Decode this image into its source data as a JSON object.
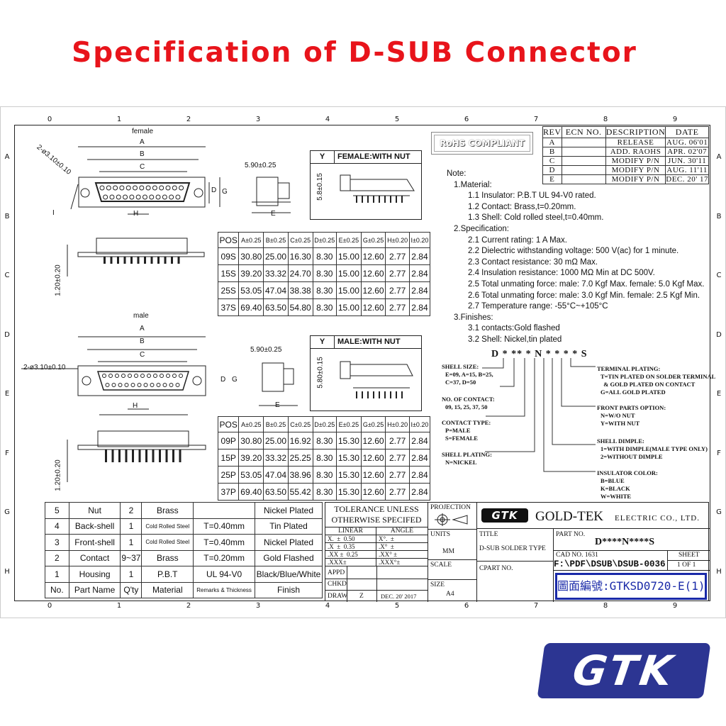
{
  "title": "Specification of D-SUB Connector",
  "grid": {
    "columns": [
      "0",
      "1",
      "2",
      "3",
      "4",
      "5",
      "6",
      "7",
      "8",
      "9"
    ],
    "rows": [
      "A",
      "B",
      "C",
      "D",
      "E",
      "F",
      "G",
      "H"
    ]
  },
  "rohs": "RoHS COMPLIANT",
  "revisions": {
    "headers": [
      "REV",
      "ECN NO.",
      "DESCRIPTION",
      "DATE"
    ],
    "rows": [
      [
        "A",
        "",
        "RELEASE",
        "AUG. 06'01"
      ],
      [
        "B",
        "",
        "ADD. RAOHS",
        "APR. 02'07"
      ],
      [
        "C",
        "",
        "MODIFY P/N",
        "JUN. 30'11"
      ],
      [
        "D",
        "",
        "MODIFY P/N",
        "AUG. 11'11"
      ],
      [
        "E",
        "",
        "MODIFY P/N",
        "DEC. 20' 17"
      ]
    ]
  },
  "female": {
    "label": "female",
    "hole": "2-ø3.10±0.10",
    "side_dim": "5.90±0.25",
    "height_dim": "1.20±0.20",
    "letters": {
      "a": "A",
      "b": "B",
      "c": "C",
      "d": "D",
      "g": "G",
      "h": "H",
      "e": "E",
      "i": "I"
    },
    "y_box": {
      "y": "Y",
      "title": "FEMALE:WITH NUT",
      "dim": "5.8±0.15"
    },
    "table": {
      "headers": [
        "POS",
        "A±0.25",
        "B±0.25",
        "C±0.25",
        "D±0.25",
        "E±0.25",
        "G±0.25",
        "H±0.20",
        "I±0.20"
      ],
      "rows": [
        [
          "09S",
          "30.80",
          "25.00",
          "16.30",
          "8.30",
          "15.00",
          "12.60",
          "2.77",
          "2.84"
        ],
        [
          "15S",
          "39.20",
          "33.32",
          "24.70",
          "8.30",
          "15.00",
          "12.60",
          "2.77",
          "2.84"
        ],
        [
          "25S",
          "53.05",
          "47.04",
          "38.38",
          "8.30",
          "15.00",
          "12.60",
          "2.77",
          "2.84"
        ],
        [
          "37S",
          "69.40",
          "63.50",
          "54.80",
          "8.30",
          "15.00",
          "12.60",
          "2.77",
          "2.84"
        ]
      ]
    }
  },
  "male": {
    "label": "male",
    "hole": "2-ø3.10±0.10",
    "side_dim": "5.90±0.25",
    "height_dim": "1.20±0.20",
    "letters": {
      "a": "A",
      "b": "B",
      "c": "C",
      "d": "D",
      "g": "G",
      "h": "H",
      "e": "E"
    },
    "y_box": {
      "y": "Y",
      "title": "MALE:WITH NUT",
      "dim": "5.80±0.15"
    },
    "table": {
      "headers": [
        "POS",
        "A±0.25",
        "B±0.25",
        "C±0.25",
        "D±0.25",
        "E±0.25",
        "G±0.25",
        "H±0.20",
        "I±0.20"
      ],
      "rows": [
        [
          "09P",
          "30.80",
          "25.00",
          "16.92",
          "8.30",
          "15.30",
          "12.60",
          "2.77",
          "2.84"
        ],
        [
          "15P",
          "39.20",
          "33.32",
          "25.25",
          "8.30",
          "15.30",
          "12.60",
          "2.77",
          "2.84"
        ],
        [
          "25P",
          "53.05",
          "47.04",
          "38.96",
          "8.30",
          "15.30",
          "12.60",
          "2.77",
          "2.84"
        ],
        [
          "37P",
          "69.40",
          "63.50",
          "55.42",
          "8.30",
          "15.30",
          "12.60",
          "2.77",
          "2.84"
        ]
      ]
    }
  },
  "notes": [
    "Note:",
    "1.Material:",
    "1.1 Insulator: P.B.T UL 94-V0 rated.",
    "1.2 Contact: Brass,t=0.20mm.",
    "1.3 Shell: Cold rolled steel,t=0.40mm.",
    "2.Specification:",
    "2.1 Current rating: 1 A Max.",
    "2.2 Dielectric withstanding voltage: 500 V(ac) for 1 minute.",
    "2.3 Contact resistance: 30 mΩ Max.",
    "2.4 Insulation resistance: 1000 MΩ Min at DC 500V.",
    "2.5 Total unmating force: male: 7.0 Kgf Max.  female: 5.0 Kgf Max.",
    "2.6 Total unmating force: male: 3.0 Kgf Min.  female: 2.5 Kgf Min.",
    "2.7 Temperature range: -55°C~+105°C",
    "3.Finishes:",
    "3.1 contacts:Gold flashed",
    "3.2 Shell: Nickel,tin plated"
  ],
  "part_code": {
    "code": "D * ** * N * * * * S",
    "shell_size": [
      "SHELL SIZE:",
      "E=09, A=15, B=25,",
      "C=37, D=50"
    ],
    "contacts": [
      "NO. OF CONTACT:",
      "09, 15, 25, 37, 50"
    ],
    "contact_type": [
      "CONTACT TYPE:",
      "P=MALE",
      "S=FEMALE"
    ],
    "shell_plating": [
      "SHELL PLATING:",
      "N=NICKEL"
    ],
    "terminal_plating": [
      "TERMINAL PLATING:",
      "T=TIN PLATED ON SOLDER TERMINAL",
      "  & GOLD PLATED ON CONTACT",
      "G=ALL GOLD PLATED"
    ],
    "front_parts": [
      "FRONT PARTS OPTION:",
      "N=W/O NUT",
      "Y=WITH NUT"
    ],
    "shell_dimple": [
      "SHELL DIMPLE:",
      "1=WITH DIMPLE(MALE TYPE ONLY)",
      "2=WITHOUT DIMPLE"
    ],
    "insulator_color": [
      "INSULATOR COLOR:",
      "B=BLUE",
      "K=BLACK",
      "W=WHITE"
    ]
  },
  "bom": {
    "rows": [
      [
        "5",
        "Nut",
        "2",
        "Brass",
        "",
        "Nickel Plated"
      ],
      [
        "4",
        "Back-shell",
        "1",
        "Cold Rolled Steel",
        "T=0.40mm",
        "Tin Plated"
      ],
      [
        "3",
        "Front-shell",
        "1",
        "Cold Rolled Steel",
        "T=0.40mm",
        "Nickel Plated"
      ],
      [
        "2",
        "Contact",
        "9~37",
        "Brass",
        "T=0.20mm",
        "Gold Flashed"
      ],
      [
        "1",
        "Housing",
        "1",
        "P.B.T",
        "UL 94-V0",
        "Black/Blue/White"
      ]
    ],
    "headers": [
      "No.",
      "Part Name",
      "Q'ty",
      "Material",
      "Remarks & Thickness",
      "Finish"
    ]
  },
  "title_block": {
    "tolerance": [
      "TOLERANCE UNLESS",
      "OTHERWISE SPECIFED"
    ],
    "linear": "LINEAR",
    "angle": "ANGLE",
    "tol_rows": [
      [
        "X.  ±  0.50",
        "X°.  ±"
      ],
      [
        ".X  ±  0.35",
        ".X°  ±"
      ],
      [
        ".XX ±  0.25",
        ".XX° ±"
      ],
      [
        ".XXX±",
        ".XXX°±"
      ]
    ],
    "appd": "APPD",
    "chkd": "CHKD",
    "draw": "DRAW",
    "drawer": "Z",
    "draw_date": "DEC. 20' 2017",
    "projection": "PROJECTION",
    "units_label": "UNITS",
    "units": "MM",
    "scale_label": "SCALE",
    "size_label": "SIZE",
    "size": "A4",
    "logo": "GTK",
    "company": "GOLD-TEK",
    "company_suffix": "ELECTRIC  CO., LTD.",
    "title_label": "TITLE",
    "title": "D-SUB SOLDER TYPE",
    "cpart_label": "CPART NO.",
    "part_no_label": "PART NO.",
    "part_no": "D****N****S",
    "cad_no": "CAD NO. 1631",
    "path": "F:\\PDF\\DSUB\\DSUB-0036",
    "sheet_label": "SHEET",
    "sheet": "1 OF 1",
    "drawing_no": "圖面編號:GTKSD0720-E(1)"
  },
  "brand_logo": "GTK",
  "colors": {
    "title_red": "#e8141b",
    "logo_blue": "#2c3592",
    "drawing_no_blue": "#1a2aa8"
  }
}
